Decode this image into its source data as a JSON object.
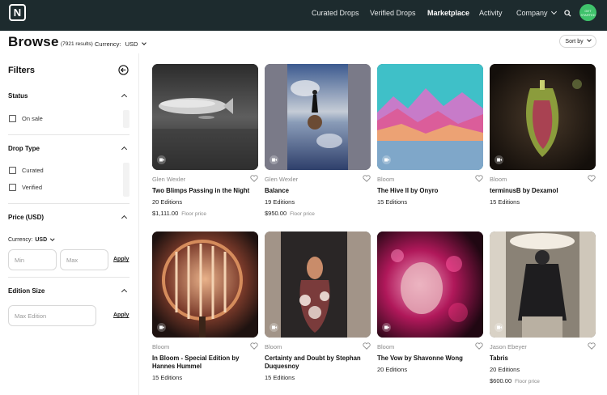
{
  "nav": {
    "logo": "N",
    "items": [
      "Curated Drops",
      "Verified Drops",
      "Marketplace",
      "Activity",
      "Company"
    ],
    "active": "Marketplace",
    "avatar_text": "GET STARTED"
  },
  "header": {
    "title": "Browse",
    "results": "(7921 results)",
    "currency_label": "Currency:",
    "currency_value": "USD",
    "sort_label": "Sort by"
  },
  "filters": {
    "title": "Filters",
    "status": {
      "title": "Status",
      "options": [
        "On sale"
      ]
    },
    "drop_type": {
      "title": "Drop Type",
      "options": [
        "Curated",
        "Verified"
      ]
    },
    "price": {
      "title": "Price (USD)",
      "currency_label": "Currency:",
      "currency_value": "USD",
      "min_placeholder": "Min",
      "max_placeholder": "Max",
      "apply": "Apply"
    },
    "edition_size": {
      "title": "Edition Size",
      "placeholder": "Max Edition",
      "apply": "Apply"
    }
  },
  "cards": [
    {
      "artist": "Glen Wexler",
      "title": "Two Blimps Passing in the Night",
      "editions": "20 Editions",
      "price": "$1,111.00",
      "floor_label": "Floor price"
    },
    {
      "artist": "Glen Wexler",
      "title": "Balance",
      "editions": "19 Editions",
      "price": "$950.00",
      "floor_label": "Floor price"
    },
    {
      "artist": "Bloom",
      "title": "The Hive II by Onyro",
      "editions": "15 Editions"
    },
    {
      "artist": "Bloom",
      "title": "terminusB by Dexamol",
      "editions": "15 Editions"
    },
    {
      "artist": "Bloom",
      "title": "In Bloom - Special Edition by Hannes Hummel",
      "editions": "15 Editions"
    },
    {
      "artist": "Bloom",
      "title": "Certainty and Doubt by Stephan Duquesnoy",
      "editions": "15 Editions"
    },
    {
      "artist": "Bloom",
      "title": "The Vow by Shavonne Wong",
      "editions": "20 Editions"
    },
    {
      "artist": "Jason Ebeyer",
      "title": "Tabris",
      "editions": "20 Editions",
      "price": "$600.00",
      "floor_label": "Floor price"
    }
  ]
}
